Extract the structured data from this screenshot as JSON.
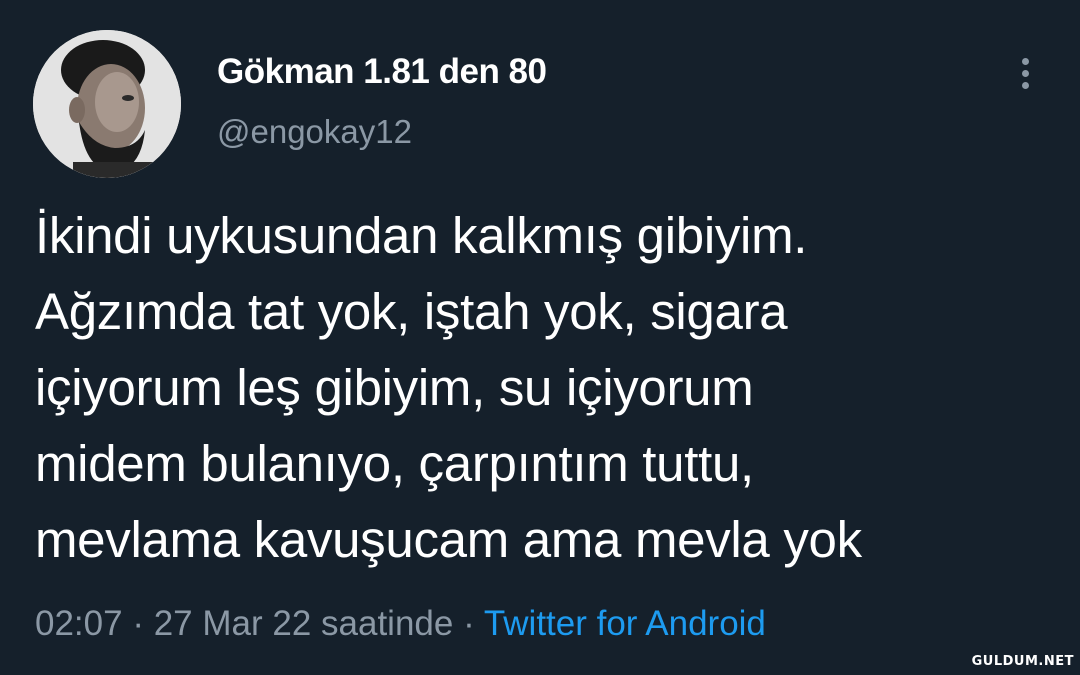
{
  "tweet": {
    "author": {
      "display_name": "Gökman 1.81 den 80",
      "handle": "@engokay12",
      "avatar_icon": "profile-photo"
    },
    "text_lines": [
      "İkindi uykusundan kalkmış gibiyim.",
      "Ağzımda tat yok, iştah yok, sigara",
      "içiyorum leş gibiyim, su içiyorum",
      "midem bulanıyo, çarpıntım tuttu,",
      "mevlama kavuşucam ama mevla yok"
    ],
    "time": "02:07",
    "separator": " · ",
    "date": "27 Mar 22 saatinde",
    "source": "Twitter for Android",
    "more_icon": "vertical-ellipsis-icon"
  },
  "colors": {
    "background": "#15202b",
    "primary_text": "#ffffff",
    "secondary_text": "#8b98a5",
    "link": "#1d9bf0"
  },
  "watermark": "GULDUM.NET"
}
